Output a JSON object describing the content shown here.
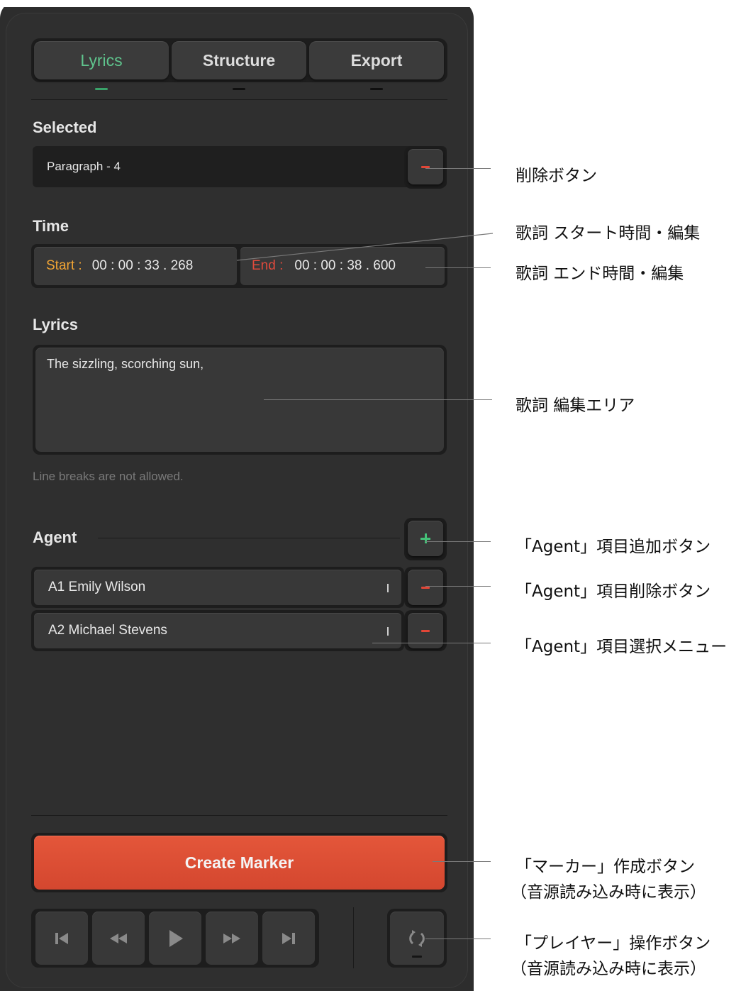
{
  "tabs": [
    {
      "label": "Lyrics",
      "active": true
    },
    {
      "label": "Structure",
      "active": false
    },
    {
      "label": "Export",
      "active": false
    }
  ],
  "selected": {
    "label": "Selected",
    "value": "Paragraph - 4"
  },
  "time": {
    "label": "Time",
    "start_label": "Start :",
    "start_value": "00 : 00 : 33 . 268",
    "end_label": "End :",
    "end_value": "00 : 00 : 38 . 600"
  },
  "lyrics": {
    "label": "Lyrics",
    "text": "The sizzling, scorching sun,",
    "hint": "Line breaks are not allowed."
  },
  "agent": {
    "label": "Agent",
    "items": [
      {
        "label": "A1 Emily Wilson"
      },
      {
        "label": "A2 Michael Stevens"
      }
    ]
  },
  "create_marker": {
    "label": "Create Marker"
  },
  "player": {
    "buttons": [
      "skip-start-icon",
      "rewind-icon",
      "play-icon",
      "fast-forward-icon",
      "skip-end-icon"
    ],
    "loop": "loop-icon"
  },
  "annotations": {
    "delete": "削除ボタン",
    "start_time": "歌詞 スタート時間・編集",
    "end_time": "歌詞 エンド時間・編集",
    "lyrics_area": "歌詞 編集エリア",
    "agent_add": "「Agent」項目追加ボタン",
    "agent_delete": "「Agent」項目削除ボタン",
    "agent_select": "「Agent」項目選択メニュー",
    "marker_line1": "「マーカー」作成ボタン",
    "marker_line2": "（音源読み込み時に表示）",
    "player_line1": "「プレイヤー」操作ボタン",
    "player_line2": "（音源読み込み時に表示）"
  },
  "colors": {
    "accent_green": "#3aa36a",
    "danger_red": "#e24637",
    "start_orange": "#f0a434",
    "create_button": "#d94c33",
    "panel_bg": "#2f2f2f"
  }
}
